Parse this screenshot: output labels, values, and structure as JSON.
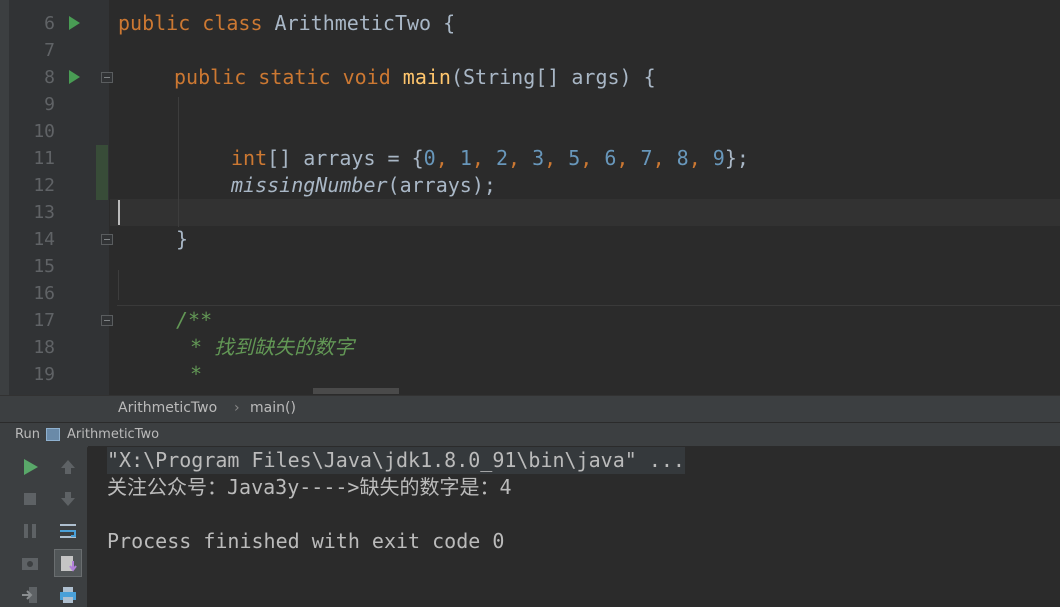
{
  "editor": {
    "line_numbers": [
      "6",
      "7",
      "8",
      "9",
      "10",
      "11",
      "12",
      "13",
      "14",
      "15",
      "16",
      "17",
      "18",
      "19"
    ],
    "code": {
      "l6_kw": "public class",
      "l6_rest": " ArithmeticTwo {",
      "l8_kw": "public static void",
      "l8_fn": "main",
      "l8_rest": "(String[] args) {",
      "l11_kw": "int",
      "l11_a": "[] arrays = {",
      "l11_nums": [
        "0",
        "1",
        "2",
        "3",
        "5",
        "6",
        "7",
        "8",
        "9"
      ],
      "l11_end": "};",
      "l12_call": "missingNumber",
      "l12_rest": "(arrays);",
      "l14": "}",
      "l17": "/**",
      "l18": " * 找到缺失的数字",
      "l19": " *"
    }
  },
  "breadcrumb": {
    "class_name": "ArithmeticTwo",
    "separator": "›",
    "method": "main()"
  },
  "run_panel": {
    "tab_label": "Run",
    "config_name": "ArithmeticTwo",
    "output": [
      "\"X:\\Program Files\\Java\\jdk1.8.0_91\\bin\\java\" ...",
      "关注公众号：Java3y---->缺失的数字是：4",
      "",
      "Process finished with exit code 0"
    ]
  },
  "theme": {
    "background": "#2b2b2b",
    "keyword": "#cc7832",
    "number": "#6897bb",
    "function": "#ffc66d",
    "comment": "#629755",
    "run_green": "#499c54"
  },
  "icons": [
    "run-gutter-icon",
    "fold-icon",
    "rerun-icon",
    "stop-icon",
    "pause-icon",
    "scroll-up-icon",
    "scroll-down-icon",
    "soft-wrap-icon",
    "camera-icon",
    "scroll-to-end-icon",
    "exit-icon",
    "print-icon"
  ]
}
